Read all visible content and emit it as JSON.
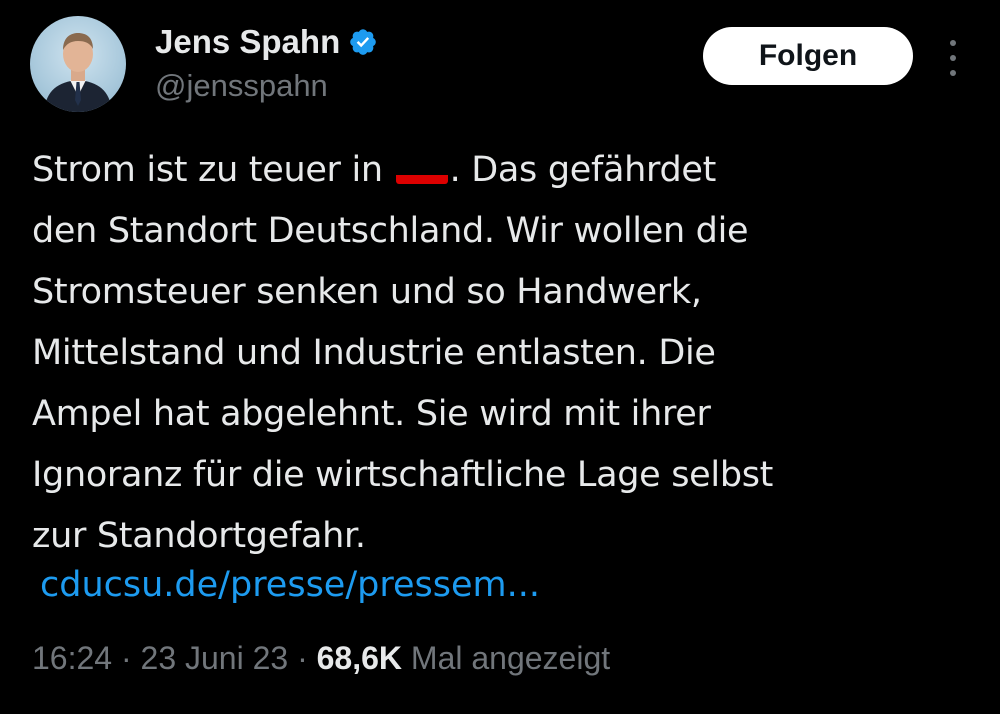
{
  "author": {
    "display_name": "Jens Spahn",
    "handle": "@jensspahn",
    "verified_icon": "verified-badge-icon",
    "avatar_icon": "avatar"
  },
  "actions": {
    "follow_label": "Folgen",
    "more_icon": "more-vertical-icon"
  },
  "tweet": {
    "line_1_before_flag": "Strom ist zu teuer in ",
    "flag_icon": "germany-flag-icon",
    "line_1_after_flag": ". Das gefährdet",
    "lines": [
      "den Standort Deutschland. Wir wollen die",
      "Stromsteuer senken und so Handwerk,",
      "Mittelstand und Industrie entlasten. Die",
      "Ampel hat abgelehnt. Sie wird mit ihrer",
      "Ignoranz für die wirtschaftliche Lage selbst",
      "zur Standortgefahr."
    ],
    "link_text": "cducsu.de/presse/pressem..."
  },
  "meta": {
    "time": "16:24",
    "separator": " · ",
    "date": "23 Juni 23",
    "views_count": "68,6K",
    "views_label": " Mal angezeigt"
  },
  "colors": {
    "background": "#000000",
    "text": "#e7e9ea",
    "muted": "#71767b",
    "link": "#1d9bf0",
    "verified": "#1d9bf0"
  }
}
